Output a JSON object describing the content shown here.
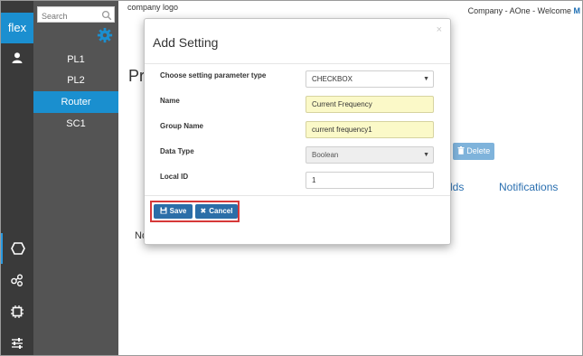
{
  "rail": {
    "brand": "flex",
    "icons": [
      "user-icon",
      "hexagon-icon",
      "nodes-icon",
      "chip-icon",
      "sliders-icon"
    ]
  },
  "sidebar": {
    "search_placeholder": "Search",
    "items": [
      {
        "label": "PL1"
      },
      {
        "label": "PL2"
      },
      {
        "label": "Router",
        "active": true
      },
      {
        "label": "SC1"
      }
    ]
  },
  "header": {
    "company_logo": "company logo",
    "welcome_text": "Company - AOne - Welcome ",
    "welcome_user": "M"
  },
  "main": {
    "title_partial": "Pr",
    "delete_label": "Delete",
    "tab_fields_partial": "lds",
    "tab_notifications": "Notifications",
    "no_data_partial": "No"
  },
  "modal": {
    "title": "Add Setting",
    "close": "×",
    "fields": {
      "param_type": {
        "label": "Choose setting parameter type",
        "value": "CHECKBOX"
      },
      "name": {
        "label": "Name",
        "value": "Current Frequency"
      },
      "group_name": {
        "label": "Group Name",
        "value": "current frequency1"
      },
      "data_type": {
        "label": "Data Type",
        "value": "Boolean"
      },
      "local_id": {
        "label": "Local ID",
        "value": "1"
      }
    },
    "save_label": "Save",
    "cancel_label": "Cancel"
  },
  "colors": {
    "accent": "#1a8fcf",
    "save_button": "#2b6ea8",
    "highlight_border": "#d63939",
    "input_highlight": "#fbf9c8"
  }
}
